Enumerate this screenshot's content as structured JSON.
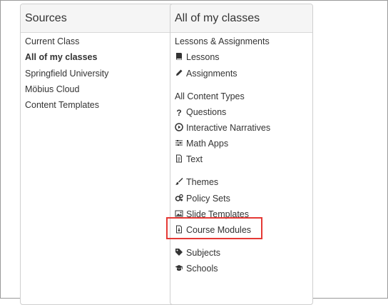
{
  "sources": {
    "title": "Sources",
    "items": [
      "Current Class",
      "All of my classes",
      "Springfield University",
      "Möbius Cloud",
      "Content Templates"
    ]
  },
  "classes": {
    "title": "All of my classes",
    "section1_title": "Lessons & Assignments",
    "lessons": "Lessons",
    "assignments": "Assignments",
    "section2_title": "All Content Types",
    "questions": "Questions",
    "interactive_narratives": "Interactive Narratives",
    "math_apps": "Math Apps",
    "text": "Text",
    "themes": "Themes",
    "policy_sets": "Policy Sets",
    "slide_templates": "Slide Templates",
    "course_modules": "Course Modules",
    "subjects": "Subjects",
    "schools": "Schools"
  },
  "colors": {
    "highlight": "#e53935",
    "header_bg": "#f5f5f5",
    "border": "#cfcfcf"
  }
}
